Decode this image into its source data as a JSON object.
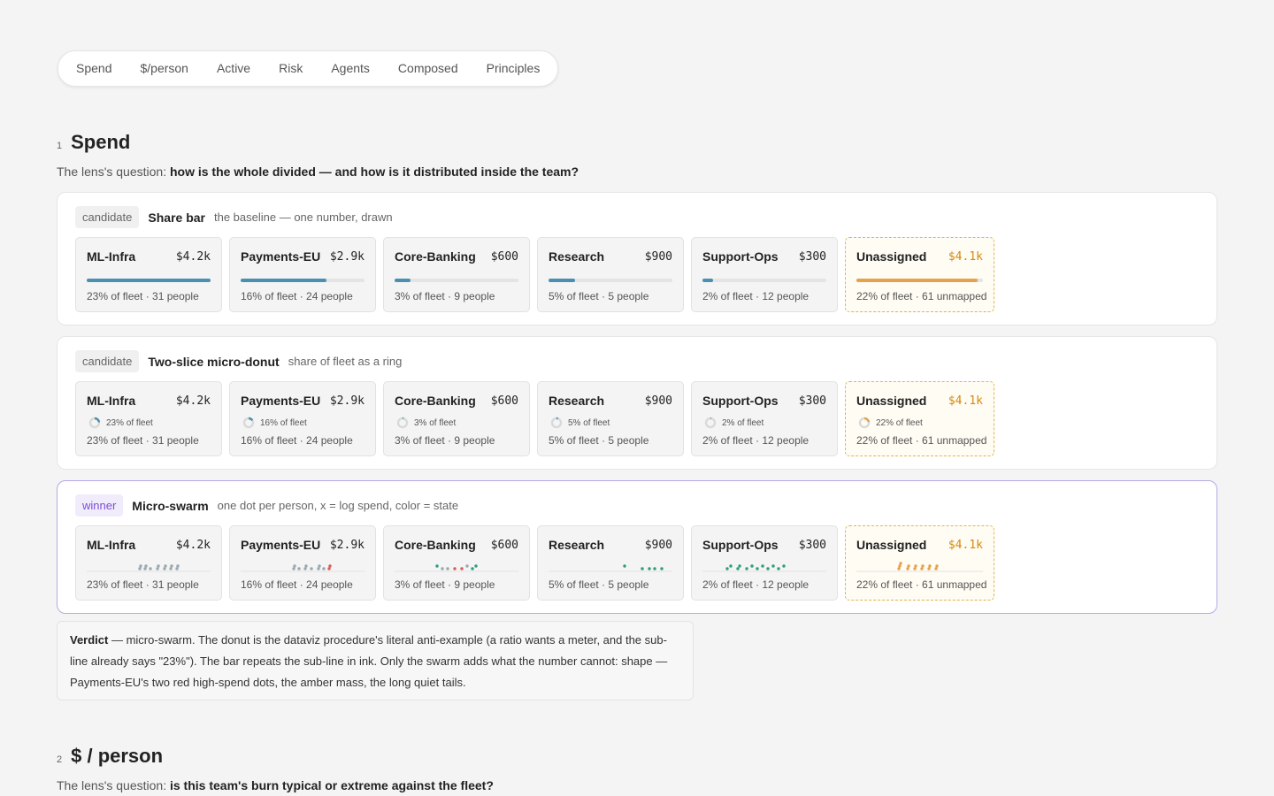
{
  "tabs": [
    "Spend",
    "$/person",
    "Active",
    "Risk",
    "Agents",
    "Composed",
    "Principles"
  ],
  "colors": {
    "bar": "#4a8fb0",
    "unassigned": "#e4a24a",
    "winner_border": "#b7a8e6",
    "state_ok": "#2e9e7a",
    "state_high": "#d85a5a",
    "state_idle": "#9aa8b0"
  },
  "sections": [
    {
      "num": "1",
      "title": "Spend",
      "question_prefix": "The lens's question:",
      "question": "how is the whole divided — and how is it distributed inside the team?"
    },
    {
      "num": "2",
      "title": "$ / person",
      "question_prefix": "The lens's question:",
      "question": "is this team's burn typical or extreme against the fleet?"
    }
  ],
  "teams": [
    {
      "name": "ML-Infra",
      "amount": "$4.2k",
      "share": 0.23,
      "share_label": "23% of fleet",
      "sub": "23% of fleet · 31 people",
      "unassigned": false
    },
    {
      "name": "Payments-EU",
      "amount": "$2.9k",
      "share": 0.16,
      "share_label": "16% of fleet",
      "sub": "16% of fleet · 24 people",
      "unassigned": false
    },
    {
      "name": "Core-Banking",
      "amount": "$600",
      "share": 0.03,
      "share_label": "3% of fleet",
      "sub": "3% of fleet · 9 people",
      "unassigned": false
    },
    {
      "name": "Research",
      "amount": "$900",
      "share": 0.05,
      "share_label": "5% of fleet",
      "sub": "5% of fleet · 5 people",
      "unassigned": false
    },
    {
      "name": "Support-Ops",
      "amount": "$300",
      "share": 0.02,
      "share_label": "2% of fleet",
      "sub": "2% of fleet · 12 people",
      "unassigned": false
    },
    {
      "name": "Unassigned",
      "amount": "$4.1k",
      "share": 0.22,
      "share_label": "22% of fleet",
      "sub": "22% of fleet · 61 unmapped",
      "unassigned": true
    }
  ],
  "candidates": [
    {
      "tag": "candidate",
      "name": "Share bar",
      "desc": "the baseline — one number, drawn",
      "kind": "bar",
      "winner": false
    },
    {
      "tag": "candidate",
      "name": "Two-slice micro-donut",
      "desc": "share of fleet as a ring",
      "kind": "donut",
      "winner": false
    },
    {
      "tag": "winner",
      "name": "Micro-swarm",
      "desc": "one dot per person, x = log spend, color = state",
      "kind": "swarm",
      "winner": true
    }
  ],
  "verdict": {
    "label": "Verdict",
    "text": " — micro-swarm. The donut is the dataviz procedure's literal anti-example (a ratio wants a meter, and the sub-line already says \"23%\"). The bar repeats the sub-line in ink. Only the swarm adds what the number cannot: shape — Payments-EU's two red high-spend dots, the amber mass, the long quiet tails."
  }
}
